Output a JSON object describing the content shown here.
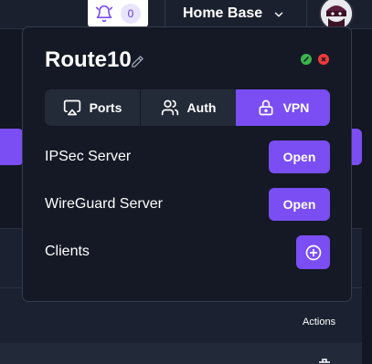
{
  "topbar": {
    "notification_count": "0",
    "site_name": "Home Base"
  },
  "popup": {
    "title": "Route10",
    "tabs": [
      {
        "label": "Ports",
        "icon": "cast-icon"
      },
      {
        "label": "Auth",
        "icon": "users-icon"
      },
      {
        "label": "VPN",
        "icon": "lock-icon",
        "active": true
      }
    ],
    "rows": [
      {
        "label": "IPSec Server",
        "action": "Open"
      },
      {
        "label": "WireGuard Server",
        "action": "Open"
      },
      {
        "label": "Clients",
        "action_icon": "plus-circle-icon"
      }
    ]
  },
  "background": {
    "actions_header": "Actions"
  },
  "colors": {
    "accent": "#7a4ef3",
    "panel": "#141925",
    "tab_bg": "#232a38",
    "status_green": "#3bb54a",
    "status_red": "#ee3b3b"
  }
}
